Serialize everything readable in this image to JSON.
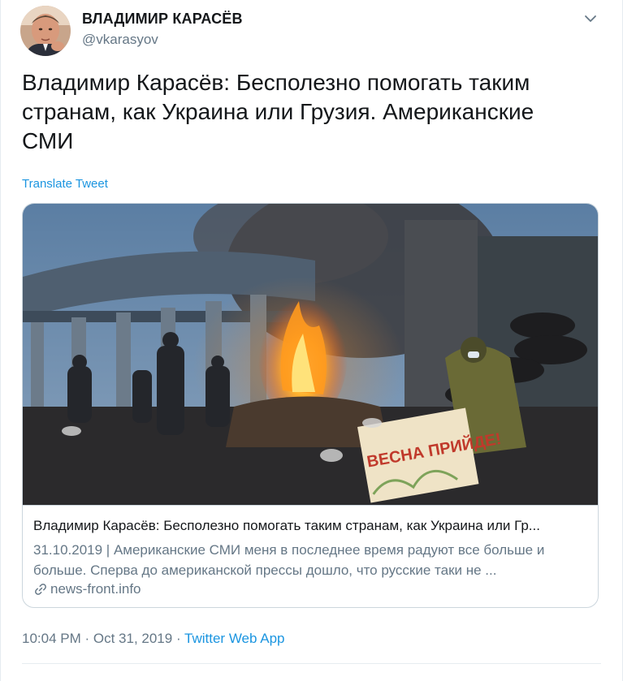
{
  "author": {
    "name": "ВЛАДИМИР КАРАСЁВ",
    "handle": "@vkarasyov"
  },
  "tweet": {
    "text": "Владимир Карасёв: Бесполезно помогать таким странам, как Украина или Грузия. Американские СМИ",
    "translate_label": "Translate Tweet"
  },
  "card": {
    "image_sign_text": "ВЕСНА ПРИЙДЕ!",
    "title": "Владимир Карасёв: Бесполезно помогать таким странам, как Украина или Гр...",
    "description": "31.10.2019 | Американские СМИ меня в последнее время радуют все больше и больше. Сперва до американской прессы дошло, что русские таки не ...",
    "domain": "news-front.info"
  },
  "meta": {
    "time": "10:04 PM",
    "separator": " · ",
    "date": "Oct 31, 2019",
    "source": "Twitter Web App"
  },
  "colors": {
    "link": "#1b95e0",
    "secondary_text": "#657786",
    "border": "#ccd6dd"
  },
  "icons": {
    "menu": "chevron-down-icon",
    "card_link": "link-icon"
  }
}
